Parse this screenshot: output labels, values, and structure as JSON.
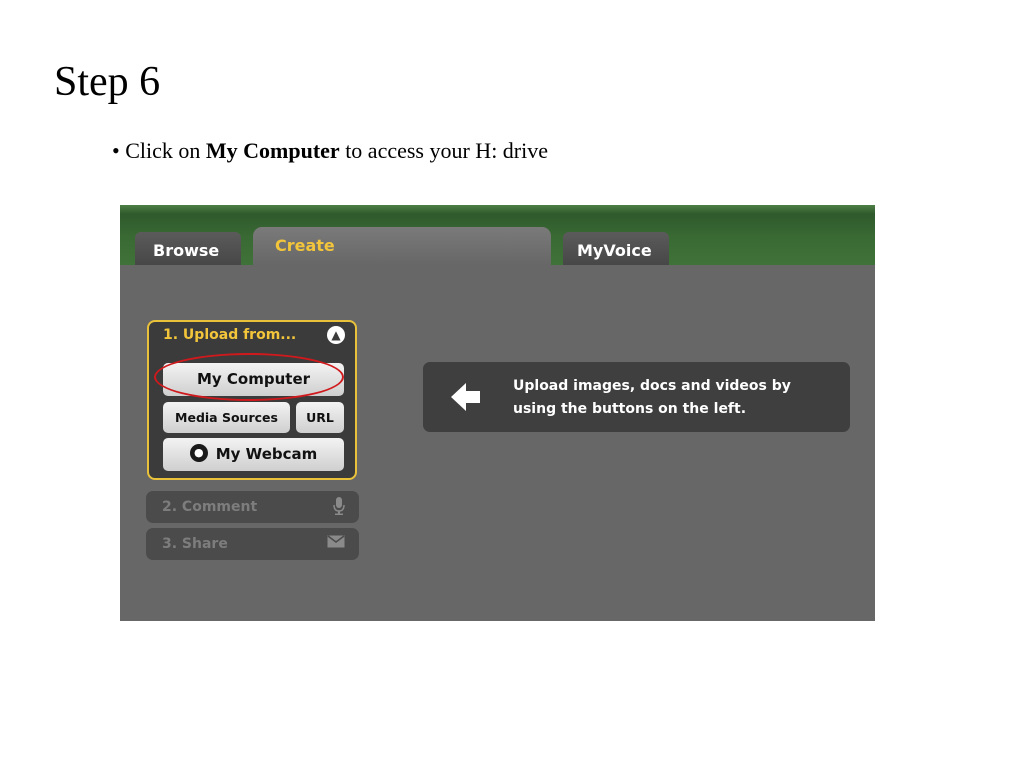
{
  "slide": {
    "title": "Step 6",
    "bullet_prefix": "• Click on ",
    "bullet_bold": "My Computer",
    "bullet_suffix": " to access your H: drive"
  },
  "app": {
    "tabs": [
      {
        "label": "Browse",
        "active": false
      },
      {
        "label": "Create",
        "active": true
      },
      {
        "label": "MyVoice",
        "active": false
      }
    ],
    "upload_panel": {
      "title": "1. Upload from...",
      "my_computer": "My Computer",
      "media_sources": "Media Sources",
      "url": "URL",
      "my_webcam": "My Webcam"
    },
    "steps": [
      {
        "label": "2. Comment",
        "icon": "microphone-icon"
      },
      {
        "label": "3. Share",
        "icon": "envelope-icon"
      }
    ],
    "info": {
      "text": "Upload images, docs and videos by using the buttons on the left."
    }
  },
  "colors": {
    "accent_yellow": "#f3c53a",
    "header_green": "#3a6a34",
    "panel_gray": "#676767",
    "highlight_red": "#d0191c"
  }
}
